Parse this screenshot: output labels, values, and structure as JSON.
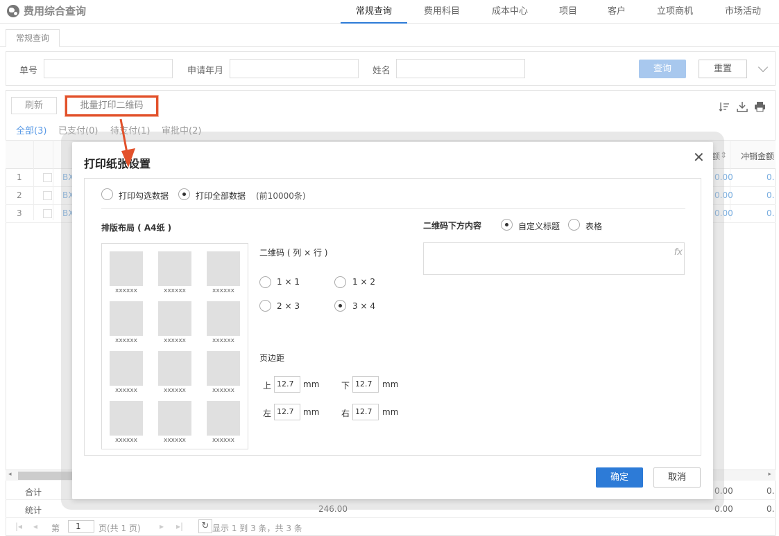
{
  "app": {
    "title": "费用综合查询"
  },
  "nav": {
    "tabs": [
      "常规查询",
      "费用科目",
      "成本中心",
      "项目",
      "客户",
      "立项商机",
      "市场活动"
    ]
  },
  "subtab": {
    "label": "常规查询"
  },
  "search": {
    "fields": [
      "单号",
      "申请年月",
      "姓名"
    ],
    "query_label": "查询",
    "reset_label": "重置"
  },
  "toolbar": {
    "refresh_label": "刷新",
    "batch_print_label": "批量打印二维码",
    "icons": [
      "sort-icon",
      "download-icon",
      "print-icon"
    ]
  },
  "status_tabs": [
    "全部(3)",
    "已支付(0)",
    "待支付(1)",
    "审批中(2)"
  ],
  "grid": {
    "header_visible": [
      "额",
      "冲销金额"
    ],
    "rows": [
      {
        "num": "1",
        "id": "BX2",
        "amount": "0.00",
        "tail": "0."
      },
      {
        "num": "2",
        "id": "BX2",
        "amount": "0.00",
        "tail": "0."
      },
      {
        "num": "3",
        "id": "BX2",
        "amount": "0.00",
        "tail": "0."
      }
    ],
    "footer": [
      {
        "label": "合计",
        "amount": "0.00",
        "tail": "0."
      },
      {
        "label": "统计",
        "mid": "246.00",
        "amount": "0.00",
        "tail": "0."
      }
    ]
  },
  "pager": {
    "page_prefix": "第",
    "page_value": "1",
    "page_suffix": "页(共 1 页)",
    "summary": "显示 1 到 3 条，共 3 条"
  },
  "modal": {
    "title": "打印纸张设置",
    "print_scope": {
      "option_selected": "打印勾选数据",
      "option_all": "打印全部数据",
      "note": "(前10000条)"
    },
    "layout": {
      "heading": "排版布局 ( A4纸 )",
      "placeholder": "xxxxxx"
    },
    "qr_grid": {
      "heading": "二维码 ( 列 × 行 )",
      "options": [
        "1 × 1",
        "1 × 2",
        "2 × 3",
        "3 × 4"
      ]
    },
    "margins": {
      "heading": "页边距",
      "top_label": "上",
      "top_value": "12.7",
      "bottom_label": "下",
      "bottom_value": "12.7",
      "left_label": "左",
      "left_value": "12.7",
      "right_label": "右",
      "right_value": "12.7",
      "unit": "mm"
    },
    "below_qr": {
      "heading": "二维码下方内容",
      "option_title": "自定义标题",
      "option_table": "表格",
      "fx": "fx"
    },
    "ok_label": "确定",
    "cancel_label": "取消"
  },
  "colors": {
    "accent": "#2d7bd7",
    "highlight": "#e2512b"
  }
}
